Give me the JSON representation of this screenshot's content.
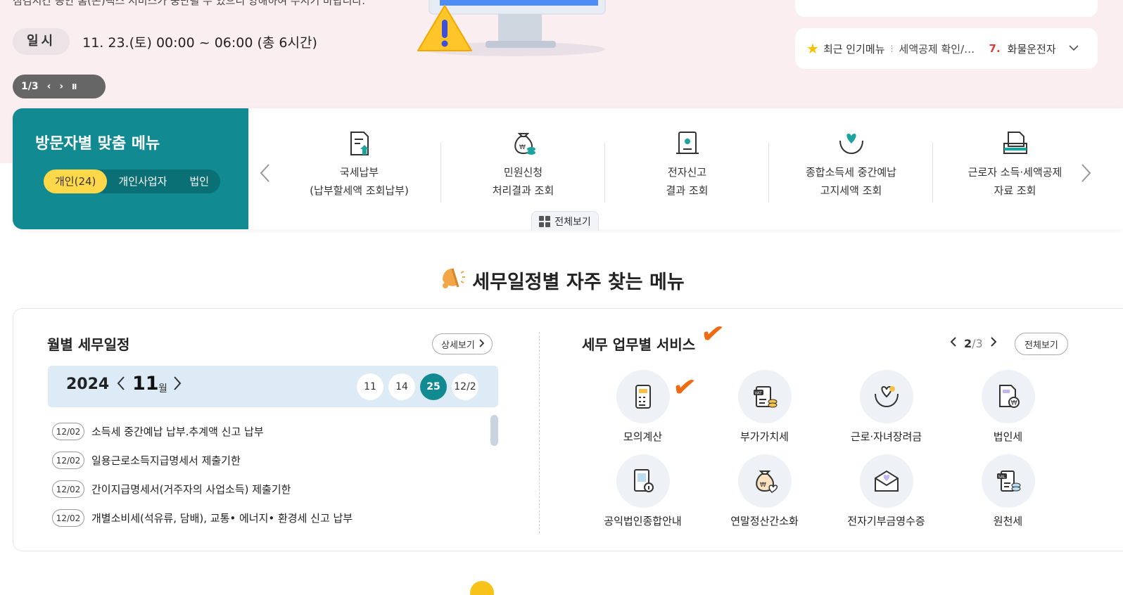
{
  "banner": {
    "cut_text": "점검시간 동안 홈(손)택스 서비스가 중단될 수 있으니 양해하여 주시기 바랍니다.",
    "when_label": "일시",
    "when_value": "11. 23.(토) 00:00 ~ 06:00 (총 6시간)",
    "pager": {
      "current": "1/3",
      "prev": "‹",
      "next": "›",
      "pause": "II"
    },
    "popular": {
      "label": "최근 인기메뉴",
      "prev_item": "세액공제 확인/변경",
      "rank": "7.",
      "current_item": "화물운전자",
      "chevron": "⌄"
    }
  },
  "visitor_menu": {
    "title": "방문자별 맞춤 메뉴",
    "segments": [
      "개인(24)",
      "개인사업자",
      "법인"
    ],
    "selected_segment": 0,
    "prev_arrow": "‹",
    "next_arrow": "›",
    "items": [
      {
        "line1": "국세납부",
        "line2": "(납부할세액 조회납부)",
        "icon": "tax-payment-icon"
      },
      {
        "line1": "민원신청",
        "line2": "처리결과 조회",
        "icon": "money-bag-icon"
      },
      {
        "line1": "전자신고",
        "line2": "결과 조회",
        "icon": "e-filing-icon"
      },
      {
        "line1": "종합소득세 중간예납",
        "line2": "고지세액 조회",
        "icon": "heart-hands-icon"
      },
      {
        "line1": "근로자 소득·세액공제",
        "line2": "자료 조회",
        "icon": "folder-document-icon"
      }
    ],
    "view_all": "전체보기"
  },
  "section": {
    "title": "세무일정별 자주 찾는 메뉴",
    "bell_icon": "🔔"
  },
  "calendar": {
    "title": "월별 세무일정",
    "detail_label": "상세보기",
    "year": "2024",
    "month": "11",
    "month_unit": "월",
    "days": [
      "11",
      "14",
      "25",
      "12/2"
    ],
    "selected_day": "25",
    "schedule": [
      {
        "date": "12/02",
        "text": "소득세 중간예납 납부.추계액 신고 납부"
      },
      {
        "date": "12/02",
        "text": "일용근로소득지급명세서 제출기한"
      },
      {
        "date": "12/02",
        "text": "간이지급명세서(거주자의 사업소득) 제출기한"
      },
      {
        "date": "12/02",
        "text": "개별소비세(석유류, 담배), 교통• 에너지• 환경세 신고 납부"
      }
    ]
  },
  "services": {
    "title": "세무 업무별 서비스",
    "page_current": "2",
    "page_sep": "/",
    "page_total": "3",
    "view_all": "전체보기",
    "items": [
      {
        "label": "모의계산",
        "icon": "calculator-icon"
      },
      {
        "label": "부가가치세",
        "icon": "vat-document-icon"
      },
      {
        "label": "근로·자녀장려금",
        "icon": "heart-hands-icon"
      },
      {
        "label": "법인세",
        "icon": "corporate-tax-icon"
      },
      {
        "label": "공익법인종합안내",
        "icon": "public-building-icon"
      },
      {
        "label": "연말정산간소화",
        "icon": "money-bag-icon"
      },
      {
        "label": "전자기부금영수증",
        "icon": "envelope-heart-icon"
      },
      {
        "label": "원천세",
        "icon": "salary-coins-icon"
      }
    ]
  },
  "annotations": {
    "check_mark": "✔"
  },
  "colors": {
    "teal": "#118a92",
    "yellow": "#ffd84a",
    "banner_pink": "#fbeef0",
    "check_orange": "#f06a12",
    "rank_red": "#e23a3a"
  }
}
